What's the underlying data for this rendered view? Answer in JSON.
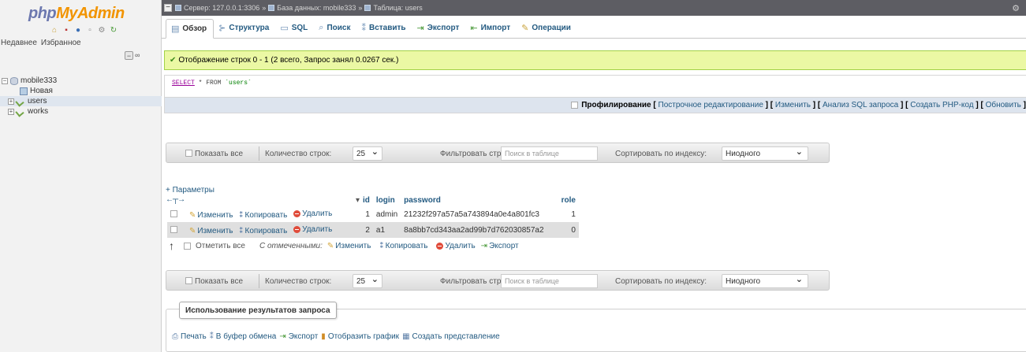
{
  "logo": {
    "part1": "php",
    "part2": "MyAdmin"
  },
  "nav": {
    "icons": [
      "home-icon",
      "exit-icon",
      "help-icon",
      "docs-icon",
      "settings-icon",
      "reload-icon"
    ],
    "recent_label": "Недавнее",
    "favorites_label": "Избранное",
    "tree": {
      "database": "mobile333",
      "new_label": "Новая",
      "tables": [
        "users",
        "works"
      ],
      "selected_table": "users"
    }
  },
  "topbar": {
    "server": "Сервер: 127.0.0.1:3306",
    "database": "База данных: mobile333",
    "table": "Таблица: users"
  },
  "tabs": [
    {
      "label": "Обзор",
      "icon": "browse-icon",
      "active": true
    },
    {
      "label": "Структура",
      "icon": "structure-icon",
      "active": false
    },
    {
      "label": "SQL",
      "icon": "sql-icon",
      "active": false
    },
    {
      "label": "Поиск",
      "icon": "search-icon",
      "active": false
    },
    {
      "label": "Вставить",
      "icon": "insert-icon",
      "active": false
    },
    {
      "label": "Экспорт",
      "icon": "export-icon",
      "active": false
    },
    {
      "label": "Импорт",
      "icon": "import-icon",
      "active": false
    },
    {
      "label": "Операции",
      "icon": "operations-icon",
      "active": false
    }
  ],
  "message": "Отображение строк 0 - 1 (2 всего, Запрос занял 0.0267 сек.)",
  "sql": {
    "select": "SELECT",
    "rest": " * FROM ",
    "table": "`users`"
  },
  "profiling": {
    "label": "Профилирование",
    "links": [
      "Построчное редактирование",
      "Изменить",
      "Анализ SQL запроса",
      "Создать PHP-код",
      "Обновить"
    ]
  },
  "filters": {
    "show_all": "Показать все",
    "row_count_label": "Количество строк:",
    "row_count_value": "25",
    "filter_label": "Фильтровать строки:",
    "filter_placeholder": "Поиск в таблице",
    "sort_label": "Сортировать по индексу:",
    "sort_value": "Ниодного"
  },
  "params_label": "+ Параметры",
  "table": {
    "columns": [
      "id",
      "login",
      "password",
      "role"
    ],
    "actions": {
      "edit": "Изменить",
      "copy": "Копировать",
      "delete": "Удалить"
    },
    "rows": [
      {
        "id": "1",
        "login": "admin",
        "password": "21232f297a57a5a743894a0e4a801fc3",
        "role": "1"
      },
      {
        "id": "2",
        "login": "a1",
        "password": "8a8bb7cd343aa2ad99b7d762030857a2",
        "role": "0"
      }
    ]
  },
  "with_selected": {
    "check_all": "Отметить все",
    "label": "С отмеченными:",
    "edit": "Изменить",
    "copy": "Копировать",
    "delete": "Удалить",
    "export": "Экспорт"
  },
  "query_results": {
    "legend": "Использование результатов запроса",
    "print": "Печать",
    "clipboard": "В буфер обмена",
    "export": "Экспорт",
    "chart": "Отобразить график",
    "view": "Создать представление"
  }
}
